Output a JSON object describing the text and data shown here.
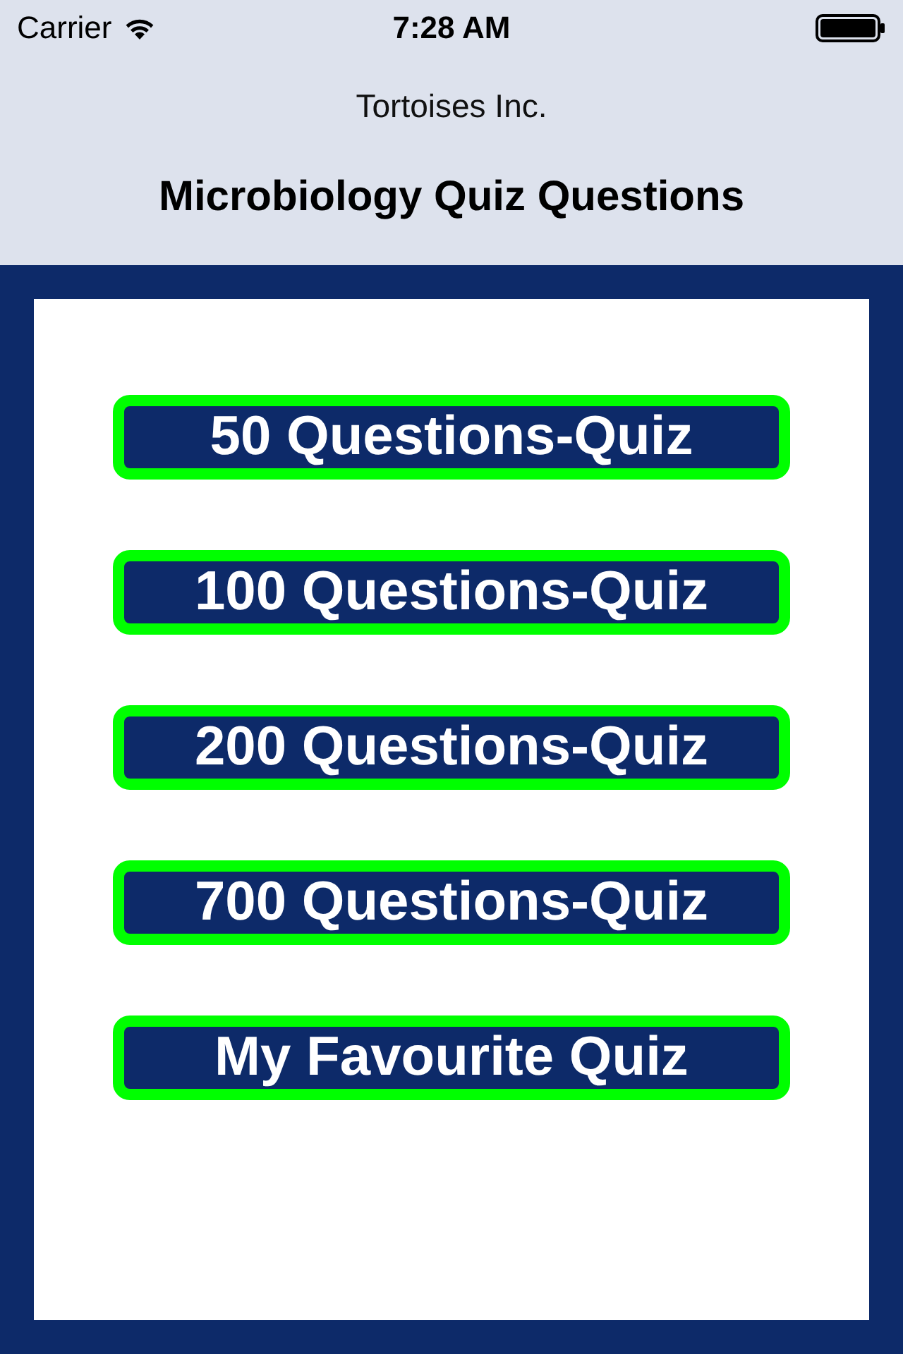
{
  "status_bar": {
    "carrier": "Carrier",
    "time": "7:28 AM"
  },
  "navigation": {
    "subtitle": "Tortoises Inc.",
    "title": "Microbiology Quiz Questions"
  },
  "buttons": [
    {
      "label": "50 Questions-Quiz"
    },
    {
      "label": "100 Questions-Quiz"
    },
    {
      "label": "200 Questions-Quiz"
    },
    {
      "label": "700 Questions-Quiz"
    },
    {
      "label": "My Favourite Quiz"
    }
  ]
}
